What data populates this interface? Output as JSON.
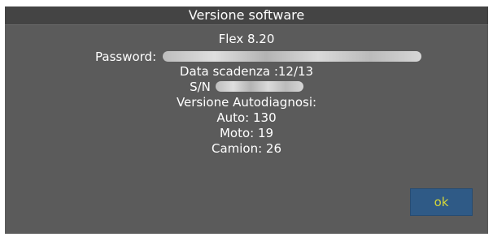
{
  "dialog": {
    "title": "Versione software",
    "version": "Flex 8.20",
    "password_label": "Password:",
    "expiry": "Data scadenza :12/13",
    "sn_label": "S/N",
    "autodiag_label": "Versione Autodiagnosi:",
    "auto": "Auto: 130",
    "moto": "Moto: 19",
    "camion": "Camion: 26",
    "ok_label": "ok"
  },
  "colors": {
    "background": "#5b5b5b",
    "titlebar": "#444444",
    "button": "#2f5a86",
    "button_text": "#d4d63a"
  }
}
